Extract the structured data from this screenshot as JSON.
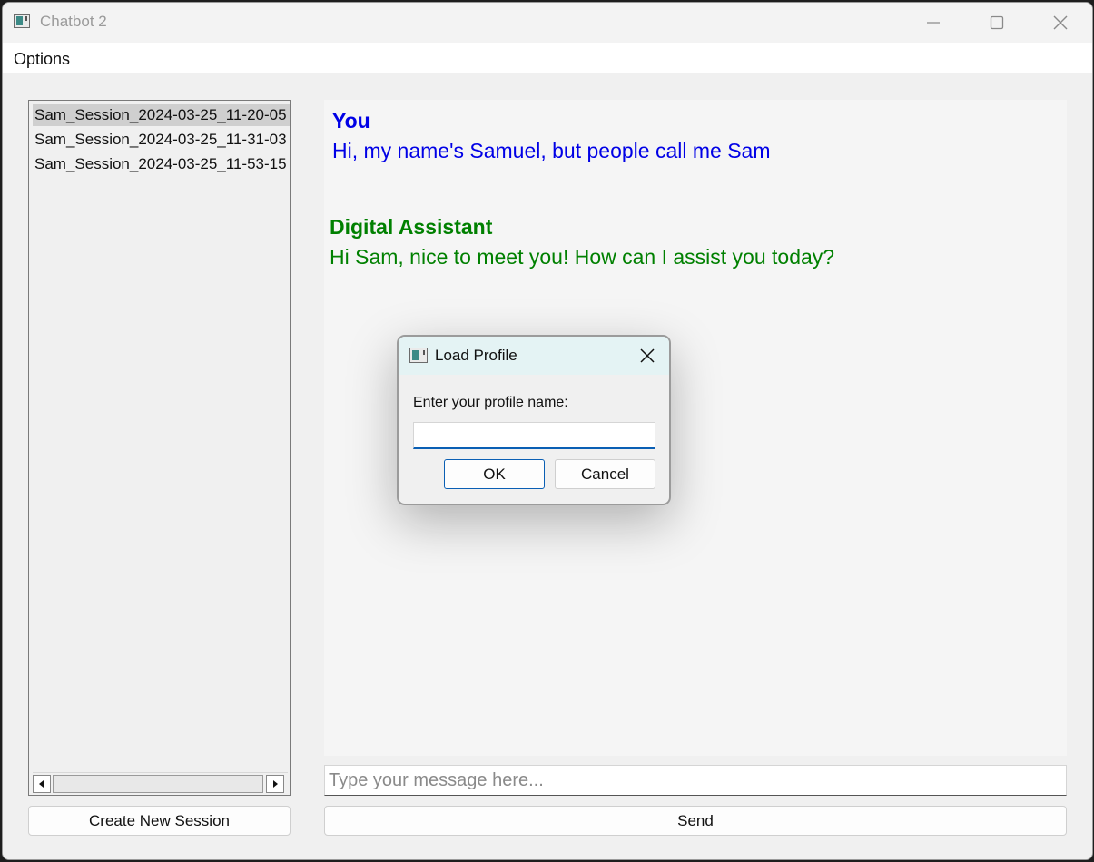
{
  "window": {
    "title": "Chatbot 2"
  },
  "menubar": {
    "options_label": "Options"
  },
  "sessions": {
    "items": [
      {
        "label": "Sam_Session_2024-03-25_11-20-05",
        "selected": true
      },
      {
        "label": "Sam_Session_2024-03-25_11-31-03",
        "selected": false
      },
      {
        "label": "Sam_Session_2024-03-25_11-53-15",
        "selected": false
      }
    ],
    "create_button_label": "Create New Session"
  },
  "chat": {
    "messages": [
      {
        "speaker": "You",
        "text": "Hi, my name's Samuel, but people call me Sam",
        "color": "#0000e6"
      },
      {
        "speaker": "Digital Assistant",
        "text": "Hi Sam, nice to meet you! How can I assist you today?",
        "color": "#008000"
      }
    ],
    "input_placeholder": "Type your message here...",
    "input_value": "",
    "send_label": "Send"
  },
  "dialog": {
    "title": "Load Profile",
    "prompt": "Enter your profile name:",
    "input_value": "",
    "ok_label": "OK",
    "cancel_label": "Cancel",
    "accent_color": "#0a5fb4"
  },
  "icons": {
    "app": "app-window-icon",
    "minimize": "minimize-icon",
    "maximize": "maximize-icon",
    "close": "close-icon",
    "scroll_left": "arrow-left-icon",
    "scroll_right": "arrow-right-icon"
  }
}
